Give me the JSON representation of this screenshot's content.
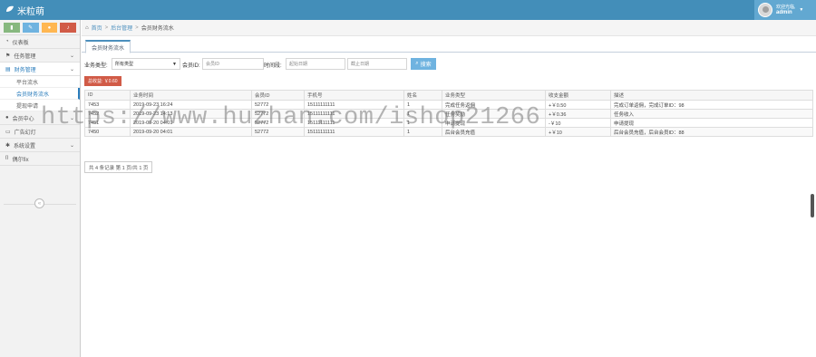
{
  "app": {
    "title": "米粒萌"
  },
  "user": {
    "greeting": "欢迎光临,",
    "name": "admin"
  },
  "shortcuts": [
    {
      "icon": "stats-icon",
      "color": "#87b87f"
    },
    {
      "icon": "pencil-icon",
      "color": "#6fb3e0"
    },
    {
      "icon": "users-icon",
      "color": "#ffb752"
    },
    {
      "icon": "bell-icon",
      "color": "#d15b47"
    }
  ],
  "sidebar": {
    "items": [
      {
        "label": "仪表板",
        "icon": "dashboard-icon"
      },
      {
        "label": "任务管理",
        "icon": "flag-icon"
      },
      {
        "label": "财务管理",
        "icon": "money-icon"
      },
      {
        "label": "会员中心",
        "icon": "user-icon"
      },
      {
        "label": "广告幻灯",
        "icon": "picture-icon"
      },
      {
        "label": "系统设置",
        "icon": "gear-icon"
      },
      {
        "label": "偶尔fix",
        "icon": "bookmark-icon"
      }
    ],
    "sub_items": [
      {
        "label": "平台流水"
      },
      {
        "label": "会员财务流水"
      },
      {
        "label": "提现申请"
      }
    ]
  },
  "breadcrumb": {
    "home": "首页",
    "sep": ">",
    "parent": "后台管理",
    "current": "会员财务流水"
  },
  "tab": {
    "label": "会员财务流水"
  },
  "filters": {
    "type_label": "业务类型:",
    "type_value": "所有类型",
    "member_label": "会员ID:",
    "member_placeholder": "会员ID",
    "time_label": "时间段:",
    "start_placeholder": "起始日期",
    "end_placeholder": "截止日期",
    "search_label": "搜索"
  },
  "total": {
    "label": "总收益:",
    "value": "￥0.60"
  },
  "table": {
    "headers": [
      "ID",
      "业务时间",
      "会员ID",
      "手机号",
      "姓名",
      "业务类型",
      "收支金额",
      "描述"
    ],
    "rows": [
      [
        "7453",
        "2019-09-23 16:24",
        "52772",
        "15111111111",
        "1",
        "完成任务返佣",
        "+￥0.50",
        "完成订单返佣，完成订单ID：98"
      ],
      [
        "7452",
        "2019-09-23 14:13",
        "52772",
        "15111111111",
        "1",
        "任务奖励",
        "+￥0.36",
        "任务收入"
      ],
      [
        "7451",
        "2019-09-20 04:01",
        "52772",
        "15111111111",
        "1",
        "申请提现",
        "-￥10",
        "申请提现"
      ],
      [
        "7450",
        "2019-09-20 04:01",
        "52772",
        "15111111111",
        "1",
        "后台会员充值",
        "+￥10",
        "后台会员充值，后台会员ID：88"
      ]
    ]
  },
  "pager": {
    "text": "共 4 条记录 第 1 页/共 1 页"
  },
  "watermark": {
    "text": "https://www.huzhan.com/ishop21266"
  }
}
